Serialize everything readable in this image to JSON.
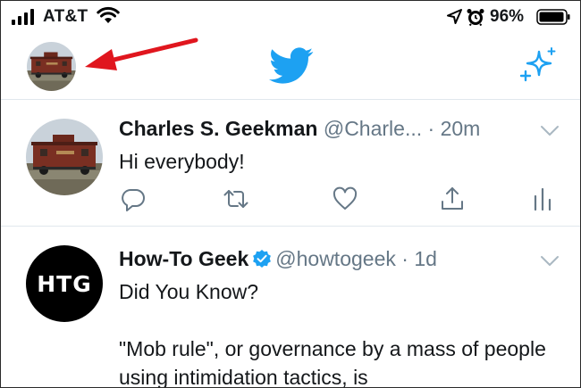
{
  "status_bar": {
    "carrier": "AT&T",
    "battery": "96%",
    "icons": [
      "signal-bars-icon",
      "wifi-icon",
      "location-arrow-icon",
      "alarm-clock-icon",
      "battery-icon"
    ]
  },
  "top_nav": {
    "icons": [
      "profile-avatar",
      "red-arrow-annotation",
      "twitter-bird-logo",
      "sparkle-icon"
    ]
  },
  "colors": {
    "twitter_blue": "#1da1f2",
    "text_primary": "#14171a",
    "text_secondary": "#657786",
    "annotation_red": "#e0161e",
    "divider": "#e1e8ed"
  },
  "tweets": [
    {
      "display_name": "Charles S. Geekman",
      "handle": "@Charle...",
      "time": "· 20m",
      "text": "Hi everybody!",
      "verified": false
    },
    {
      "display_name": "How-To Geek",
      "handle": "@howtogeek",
      "time": "· 1d",
      "avatar_text": "HTG",
      "text_lines": [
        "Did You Know?",
        "\"Mob rule\", or governance by a mass of people using intimidation tactics, is"
      ],
      "verified": true
    }
  ],
  "tweet_actions": [
    "reply-icon",
    "retweet-icon",
    "like-icon",
    "share-icon",
    "analytics-icon"
  ]
}
